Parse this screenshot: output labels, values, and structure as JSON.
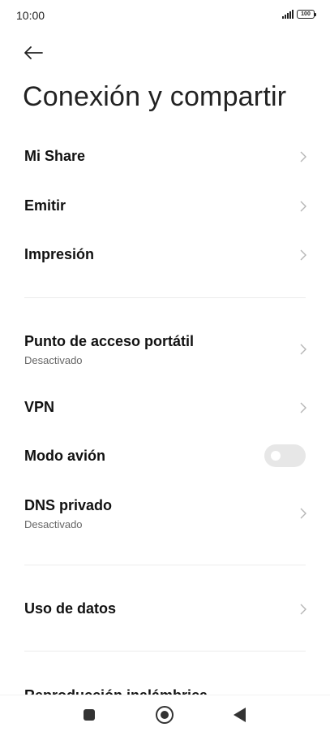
{
  "status_bar": {
    "time": "10:00",
    "battery": "100"
  },
  "header": {
    "title": "Conexión y compartir"
  },
  "items": {
    "mi_share": {
      "title": "Mi Share"
    },
    "emitir": {
      "title": "Emitir"
    },
    "impresion": {
      "title": "Impresión"
    },
    "hotspot": {
      "title": "Punto de acceso portátil",
      "subtitle": "Desactivado"
    },
    "vpn": {
      "title": "VPN"
    },
    "airplane": {
      "title": "Modo avión",
      "enabled": false
    },
    "dns": {
      "title": "DNS privado",
      "subtitle": "Desactivado"
    },
    "data_usage": {
      "title": "Uso de datos"
    },
    "wireless_display": {
      "title": "Reproducción inalámbrica"
    }
  },
  "icons": {
    "back": "arrow-left-icon",
    "chevron": "chevron-right-icon",
    "recent": "square-icon",
    "home": "circle-icon",
    "nav_back": "triangle-left-icon"
  },
  "colors": {
    "text_primary": "#111111",
    "text_secondary": "#666666",
    "toggle_off": "#e7e7e7",
    "chevron": "#b5b5b5"
  }
}
